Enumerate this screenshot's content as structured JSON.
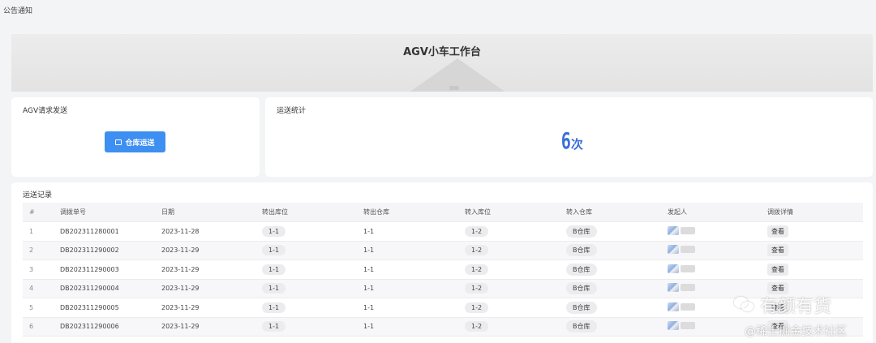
{
  "header": {
    "notice_label": "公告通知"
  },
  "banner": {
    "title": "AGV小车工作台"
  },
  "agv_card": {
    "title": "AGV请求发送",
    "button_label": "仓库运送"
  },
  "stats_card": {
    "title": "运送统计",
    "count": "6",
    "unit": "次"
  },
  "records": {
    "title": "运送记录",
    "columns": [
      "#",
      "调拨单号",
      "日期",
      "转出库位",
      "转出仓库",
      "转入库位",
      "转入仓库",
      "发起人",
      "调拨详情"
    ],
    "rows": [
      {
        "idx": "1",
        "order_no": "DB202311280001",
        "date": "2023-11-28",
        "out_loc": "1-1",
        "out_wh": "1-1",
        "in_loc": "1-2",
        "in_wh": "B仓库",
        "detail": "查看"
      },
      {
        "idx": "2",
        "order_no": "DB202311290002",
        "date": "2023-11-29",
        "out_loc": "1-1",
        "out_wh": "1-1",
        "in_loc": "1-2",
        "in_wh": "B仓库",
        "detail": "查看"
      },
      {
        "idx": "3",
        "order_no": "DB202311290003",
        "date": "2023-11-29",
        "out_loc": "1-1",
        "out_wh": "1-1",
        "in_loc": "1-2",
        "in_wh": "B仓库",
        "detail": "查看"
      },
      {
        "idx": "4",
        "order_no": "DB202311290004",
        "date": "2023-11-29",
        "out_loc": "1-1",
        "out_wh": "1-1",
        "in_loc": "1-2",
        "in_wh": "B仓库",
        "detail": "查看"
      },
      {
        "idx": "5",
        "order_no": "DB202311290005",
        "date": "2023-11-29",
        "out_loc": "1-1",
        "out_wh": "1-1",
        "in_loc": "1-2",
        "in_wh": "B仓库",
        "detail": "查看"
      },
      {
        "idx": "6",
        "order_no": "DB202311290006",
        "date": "2023-11-29",
        "out_loc": "1-1",
        "out_wh": "1-1",
        "in_loc": "1-2",
        "in_wh": "B仓库",
        "detail": "查看"
      }
    ]
  },
  "watermark": {
    "line1": "有颜有货",
    "line2": "@稀土掘金技术社区"
  },
  "colors": {
    "accent": "#3d8ff1",
    "stat": "#3d6fd8",
    "background": "#f3f4f6"
  }
}
